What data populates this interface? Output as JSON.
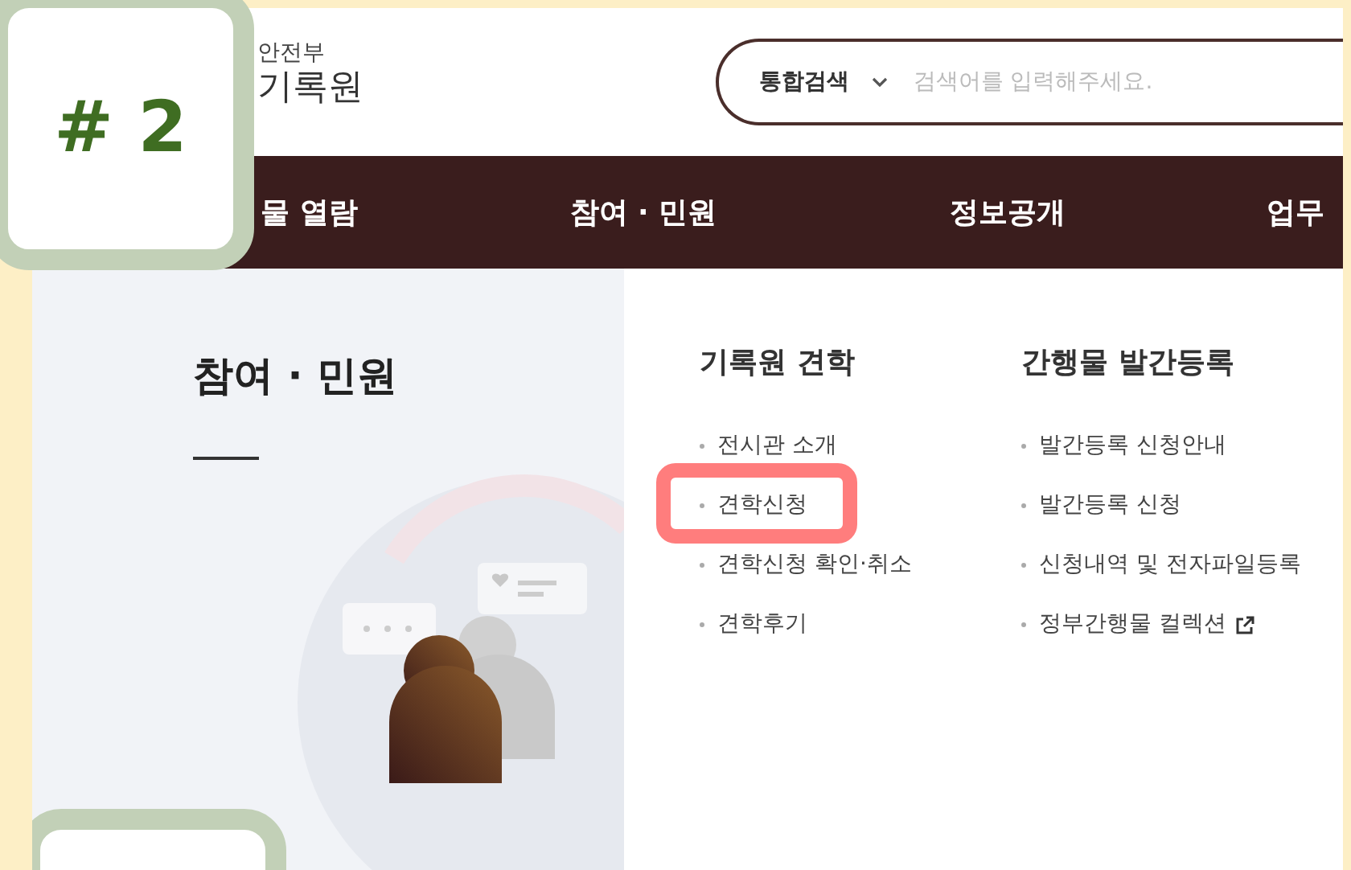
{
  "logo": {
    "line_1": "안전부",
    "line_2": "기록원"
  },
  "search": {
    "scope": "통합검색",
    "placeholder": "검색어를 입력해주세요."
  },
  "nav": [
    {
      "label": "물 열람",
      "selected": false
    },
    {
      "label": "참여 · 민원",
      "selected": false
    },
    {
      "label": "정보공개",
      "selected": false
    },
    {
      "label": "업무",
      "selected": false
    }
  ],
  "section": {
    "title": "참여 · 민원"
  },
  "menu_columns": [
    {
      "heading": "기록원 견학",
      "items": [
        {
          "label": "전시관 소개",
          "highlighted": false,
          "external": false
        },
        {
          "label": "견학신청",
          "highlighted": true,
          "external": false
        },
        {
          "label": "견학신청 확인·취소",
          "highlighted": false,
          "external": false
        },
        {
          "label": "견학후기",
          "highlighted": false,
          "external": false
        }
      ]
    },
    {
      "heading": "간행물 발간등록",
      "items": [
        {
          "label": "발간등록 신청안내",
          "highlighted": false,
          "external": false
        },
        {
          "label": "발간등록 신청",
          "highlighted": false,
          "external": false
        },
        {
          "label": "신청내역 및 전자파일등록",
          "highlighted": false,
          "external": false
        },
        {
          "label": "정부간행물 컬렉션",
          "highlighted": false,
          "external": true
        }
      ]
    }
  ],
  "step_badge": {
    "label": "# 2"
  }
}
